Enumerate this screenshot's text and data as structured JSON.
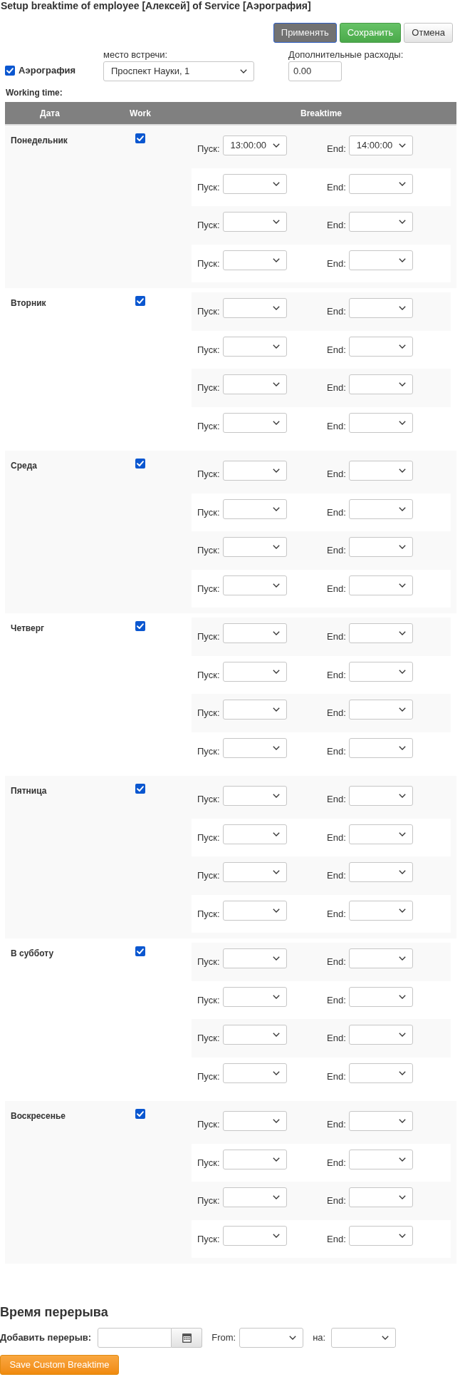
{
  "title": "Setup breaktime of employee [Алексей] of Service [Аэрография]",
  "buttons": [
    {
      "label": "Применять",
      "kind": "apply"
    },
    {
      "label": "Сохранить",
      "kind": "save"
    },
    {
      "label": "Отмена",
      "kind": "cancel"
    }
  ],
  "service": {
    "label": "Аэрография",
    "checked": true
  },
  "meeting_place": {
    "label": "место встречи:",
    "value": "Проспект Науки, 1"
  },
  "extra_costs": {
    "label": "Дополнительные расходы:",
    "value": "0.00"
  },
  "working_time": {
    "label": "Working time:",
    "columns": [
      "Дата",
      "Work",
      "Breaktime"
    ],
    "rows": [
      {
        "day": "Понедельник",
        "work": true,
        "breaks": [
          {
            "start_label": "Пуск:",
            "start": "13:00:00",
            "end_label": "End:",
            "end": "14:00:00"
          },
          {
            "start_label": "Пуск:",
            "end_label": "End:"
          },
          {
            "start_label": "Пуск:",
            "end_label": "End:"
          },
          {
            "start_label": "Пуск:",
            "end_label": "End:"
          }
        ]
      },
      {
        "day": "Вторник",
        "work": true,
        "breaks": [
          {
            "start_label": "Пуск:",
            "end_label": "End:"
          },
          {
            "start_label": "Пуск:",
            "end_label": "End:"
          },
          {
            "start_label": "Пуск:",
            "end_label": "End:"
          },
          {
            "start_label": "Пуск:",
            "end_label": "End:"
          }
        ]
      },
      {
        "day": "Среда",
        "work": true,
        "breaks": [
          {
            "start_label": "Пуск:",
            "end_label": "End:"
          },
          {
            "start_label": "Пуск:",
            "end_label": "End:"
          },
          {
            "start_label": "Пуск:",
            "end_label": "End:"
          },
          {
            "start_label": "Пуск:",
            "end_label": "End:"
          }
        ]
      },
      {
        "day": "Четверг",
        "work": true,
        "breaks": [
          {
            "start_label": "Пуск:",
            "end_label": "End:"
          },
          {
            "start_label": "Пуск:",
            "end_label": "End:"
          },
          {
            "start_label": "Пуск:",
            "end_label": "End:"
          },
          {
            "start_label": "Пуск:",
            "end_label": "End:"
          }
        ]
      },
      {
        "day": "Пятница",
        "work": true,
        "breaks": [
          {
            "start_label": "Пуск:",
            "end_label": "End:"
          },
          {
            "start_label": "Пуск:",
            "end_label": "End:"
          },
          {
            "start_label": "Пуск:",
            "end_label": "End:"
          },
          {
            "start_label": "Пуск:",
            "end_label": "End:"
          }
        ]
      },
      {
        "day": "В субботу",
        "work": true,
        "breaks": [
          {
            "start_label": "Пуск:",
            "end_label": "End:"
          },
          {
            "start_label": "Пуск:",
            "end_label": "End:"
          },
          {
            "start_label": "Пуск:",
            "end_label": "End:"
          },
          {
            "start_label": "Пуск:",
            "end_label": "End:"
          }
        ]
      },
      {
        "day": "Воскресенье",
        "work": true,
        "breaks": [
          {
            "start_label": "Пуск:",
            "end_label": "End:"
          },
          {
            "start_label": "Пуск:",
            "end_label": "End:"
          },
          {
            "start_label": "Пуск:",
            "end_label": "End:"
          },
          {
            "start_label": "Пуск:",
            "end_label": "End:"
          }
        ]
      }
    ]
  },
  "custom_breaktime": {
    "heading": "Время перерыва",
    "add_label": "Добавить перерыв:",
    "from_label": "From:",
    "to_label": "на:",
    "save_button": "Save Custom Breaktime"
  }
}
